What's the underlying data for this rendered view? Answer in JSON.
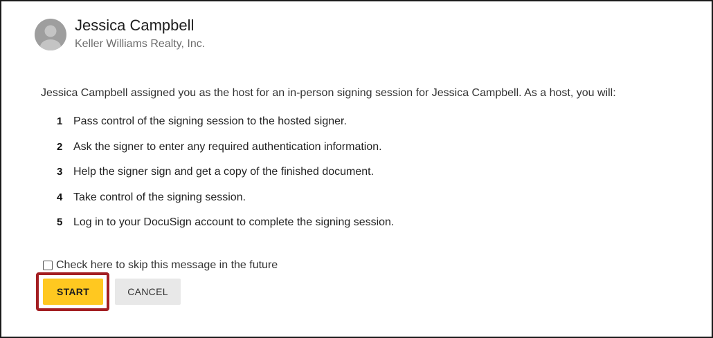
{
  "sender": {
    "name": "Jessica Campbell",
    "company": "Keller Williams Realty, Inc."
  },
  "intro_text": "Jessica Campbell assigned you as the host for an in-person signing session for Jessica Campbell. As a host, you will:",
  "steps": [
    {
      "num": "1",
      "text": "Pass control of the signing session to the hosted signer."
    },
    {
      "num": "2",
      "text": "Ask the signer to enter any required authentication information."
    },
    {
      "num": "3",
      "text": "Help the signer sign and get a copy of the finished document."
    },
    {
      "num": "4",
      "text": "Take control of the signing session."
    },
    {
      "num": "5",
      "text": "Log in to your DocuSign account to complete the signing session."
    }
  ],
  "skip_checkbox": {
    "label": "Check here to skip this message in the future",
    "checked": false
  },
  "buttons": {
    "start_label": "START",
    "cancel_label": "CANCEL"
  },
  "colors": {
    "start_button": "#ffc820",
    "cancel_button": "#e8e8e8",
    "highlight_border": "#a31e22",
    "avatar": "#9e9e9e"
  },
  "icons": {
    "avatar": "user-silhouette-icon"
  }
}
